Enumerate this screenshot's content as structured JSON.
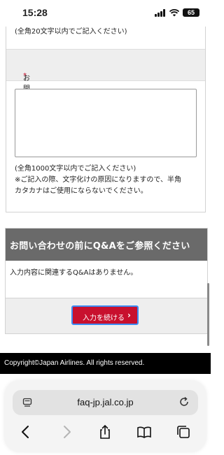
{
  "status_bar": {
    "time": "15:28",
    "battery": "65"
  },
  "form": {
    "name_note": "(全角20文字以内でご記入ください)",
    "inquiry_label": "お問い合わせ内容",
    "required_mark": "*",
    "inquiry_value": "",
    "inquiry_note_1": "(全角1000文字以内でご記入ください)",
    "inquiry_note_2": "※ご記入の際、文字化けの原因になりますので、半角",
    "inquiry_note_3": "カタカナはご使用にならないでください。"
  },
  "qa": {
    "header": "お問い合わせの前にQ&Aをご参照ください",
    "body": "入力内容に関連するQ&Aはありません。",
    "continue_label": "入力を続ける",
    "continue_chevron": "›"
  },
  "footer": {
    "copyright": "Copyright©Japan Airlines. All rights reserved."
  },
  "browser": {
    "url": "faq-jp.jal.co.jp",
    "icons": [
      "tabs-icon",
      "reload-icon",
      "back-icon",
      "forward-icon",
      "share-icon",
      "bookmarks-icon",
      "tab-switcher-icon"
    ]
  },
  "colors": {
    "accent_red": "#c8102e",
    "focus_blue": "#3d8cf4",
    "header_gray": "#6a6a6a",
    "footer_black": "#000000"
  }
}
